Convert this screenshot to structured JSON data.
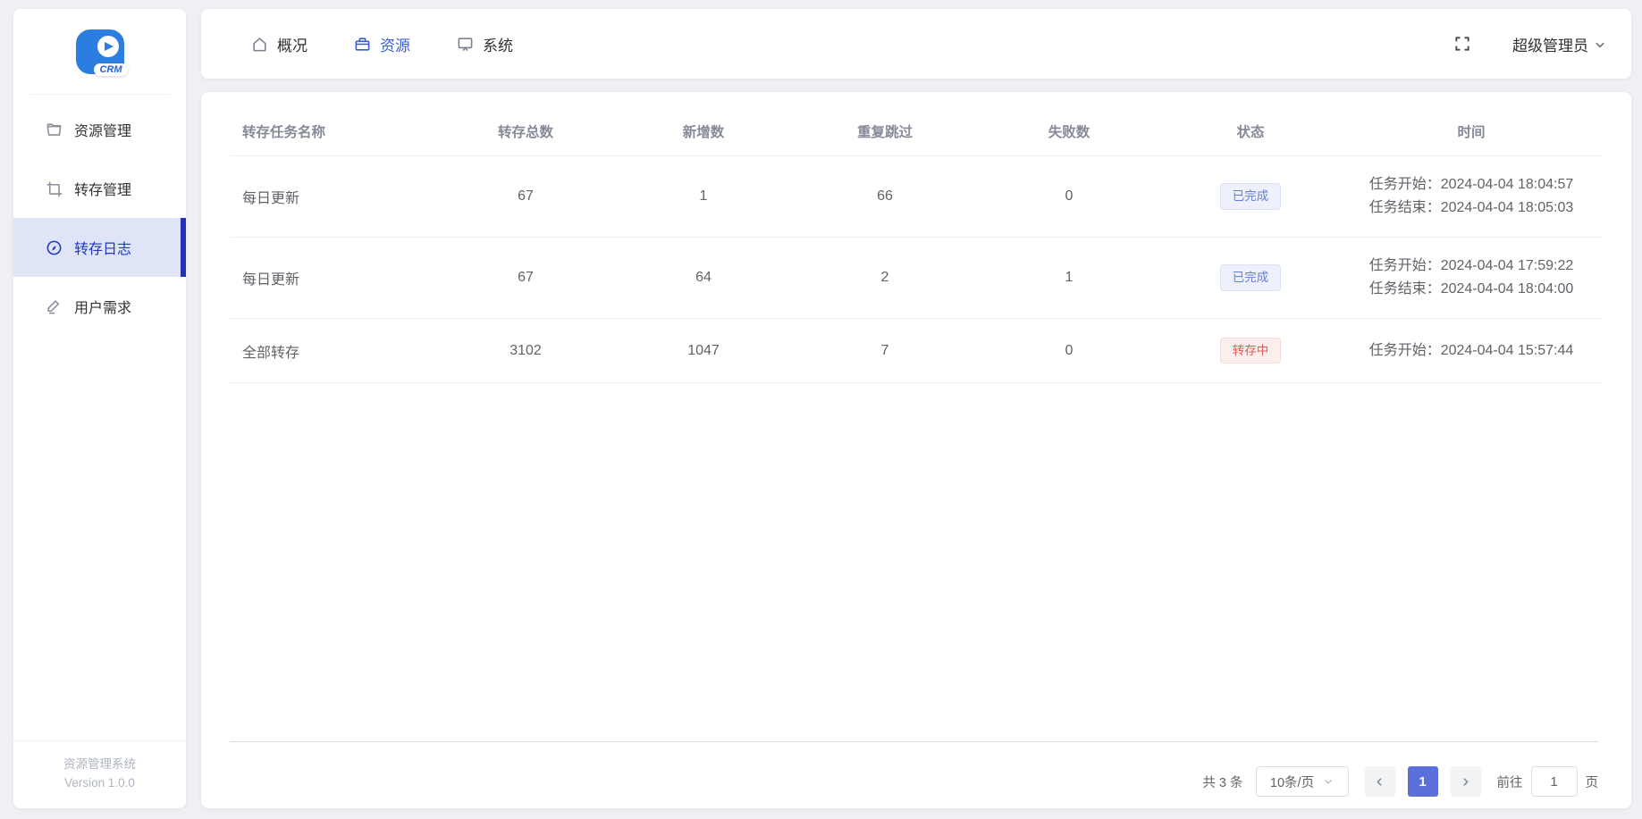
{
  "app": {
    "logo_text": "CRM",
    "footer_line1": "资源管理系统",
    "footer_line2": "Version 1.0.0"
  },
  "sidebar": {
    "items": [
      {
        "label": "资源管理",
        "icon": "folder-icon",
        "active": false
      },
      {
        "label": "转存管理",
        "icon": "crop-icon",
        "active": false
      },
      {
        "label": "转存日志",
        "icon": "compass-icon",
        "active": true
      },
      {
        "label": "用户需求",
        "icon": "edit-icon",
        "active": false
      }
    ]
  },
  "topnav": {
    "tabs": [
      {
        "label": "概况",
        "icon": "home-icon",
        "active": false
      },
      {
        "label": "资源",
        "icon": "suitcase-icon",
        "active": true
      },
      {
        "label": "系统",
        "icon": "monitor-icon",
        "active": false
      }
    ],
    "fullscreen_icon": "fullscreen-icon",
    "user_name": "超级管理员"
  },
  "table": {
    "columns": [
      "转存任务名称",
      "转存总数",
      "新增数",
      "重复跳过",
      "失败数",
      "状态",
      "时间"
    ],
    "rows": [
      {
        "name": "每日更新",
        "total": "67",
        "added": "1",
        "skipped": "66",
        "failed": "0",
        "status": "已完成",
        "status_type": "info",
        "time_start": "任务开始：2024-04-04 18:04:57",
        "time_end": "任务结束：2024-04-04 18:05:03"
      },
      {
        "name": "每日更新",
        "total": "67",
        "added": "64",
        "skipped": "2",
        "failed": "1",
        "status": "已完成",
        "status_type": "info",
        "time_start": "任务开始：2024-04-04 17:59:22",
        "time_end": "任务结束：2024-04-04 18:04:00"
      },
      {
        "name": "全部转存",
        "total": "3102",
        "added": "1047",
        "skipped": "7",
        "failed": "0",
        "status": "转存中",
        "status_type": "danger",
        "time_start": "任务开始：2024-04-04 15:57:44",
        "time_end": ""
      }
    ]
  },
  "pagination": {
    "total_text": "共 3 条",
    "page_size": "10条/页",
    "current_page": "1",
    "goto_label": "前往",
    "goto_value": "1",
    "page_unit": "页"
  },
  "colors": {
    "page_background": "#eef0f5",
    "accent_blue": "#3a5ccc",
    "sidebar_active_bg": "#dfe5f6",
    "sidebar_active_text": "#1d39c4",
    "sidebar_active_bar": "#2333b0",
    "status_info_text": "#657fd8",
    "status_danger_text": "#e05a5a",
    "pagination_active_bg": "#5a6fd9",
    "logo_blue": "#2b7de0"
  }
}
